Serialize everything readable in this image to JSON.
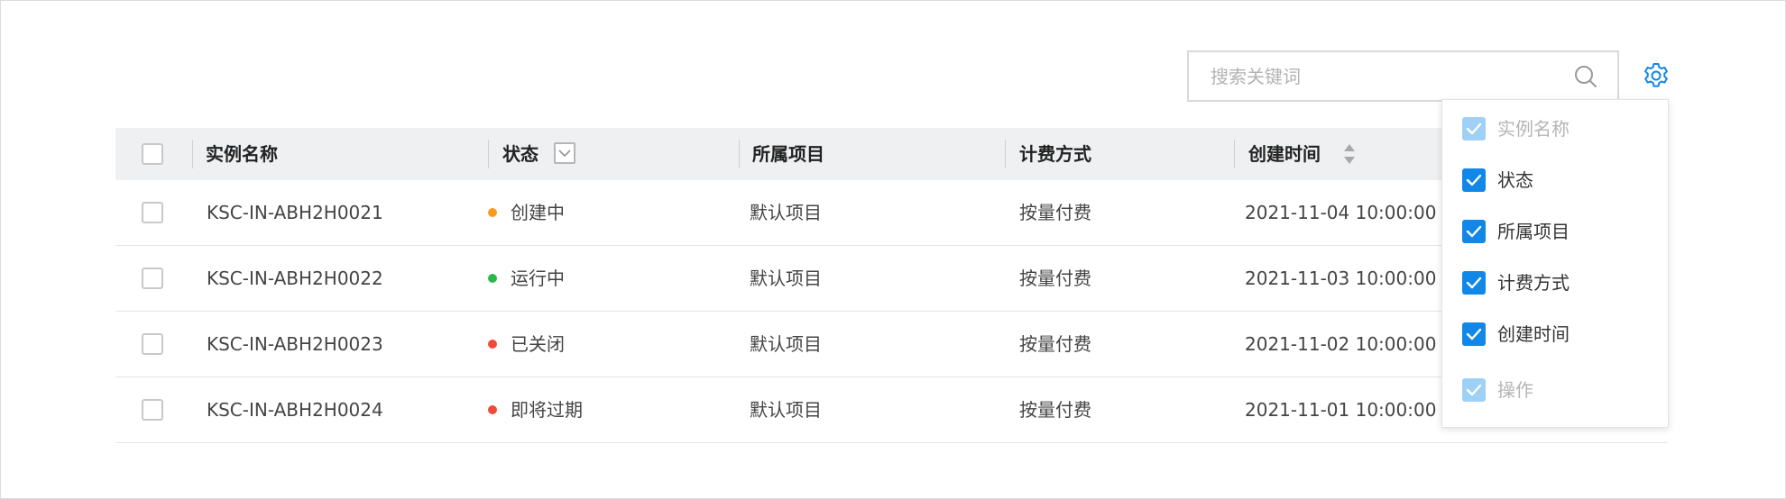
{
  "search": {
    "placeholder": "搜索关键词"
  },
  "colors": {
    "accent": "#1187e8",
    "accent_disabled": "#9fd0f5",
    "status_creating": "#fa9b1e",
    "status_running": "#2db74b",
    "status_closed": "#f04b3a"
  },
  "table": {
    "columns": [
      {
        "label": "实例名称"
      },
      {
        "label": "状态"
      },
      {
        "label": "所属项目"
      },
      {
        "label": "计费方式"
      },
      {
        "label": "创建时间"
      }
    ],
    "rows": [
      {
        "name": "KSC-IN-ABH2H0021",
        "status": "创建中",
        "status_color": "#fa9b1e",
        "project": "默认项目",
        "billing": "按量付费",
        "created": "2021-11-04 10:00:00"
      },
      {
        "name": "KSC-IN-ABH2H0022",
        "status": "运行中",
        "status_color": "#2db74b",
        "project": "默认项目",
        "billing": "按量付费",
        "created": "2021-11-03 10:00:00"
      },
      {
        "name": "KSC-IN-ABH2H0023",
        "status": "已关闭",
        "status_color": "#f04b3a",
        "project": "默认项目",
        "billing": "按量付费",
        "created": "2021-11-02 10:00:00"
      },
      {
        "name": "KSC-IN-ABH2H0024",
        "status": "即将过期",
        "status_color": "#f04b3a",
        "project": "默认项目",
        "billing": "按量付费",
        "created": "2021-11-01 10:00:00"
      }
    ]
  },
  "column_settings": {
    "items": [
      {
        "label": "实例名称",
        "checked": true,
        "disabled": true
      },
      {
        "label": "状态",
        "checked": true,
        "disabled": false
      },
      {
        "label": "所属项目",
        "checked": true,
        "disabled": false
      },
      {
        "label": "计费方式",
        "checked": true,
        "disabled": false
      },
      {
        "label": "创建时间",
        "checked": true,
        "disabled": false
      },
      {
        "label": "操作",
        "checked": true,
        "disabled": true
      }
    ]
  }
}
